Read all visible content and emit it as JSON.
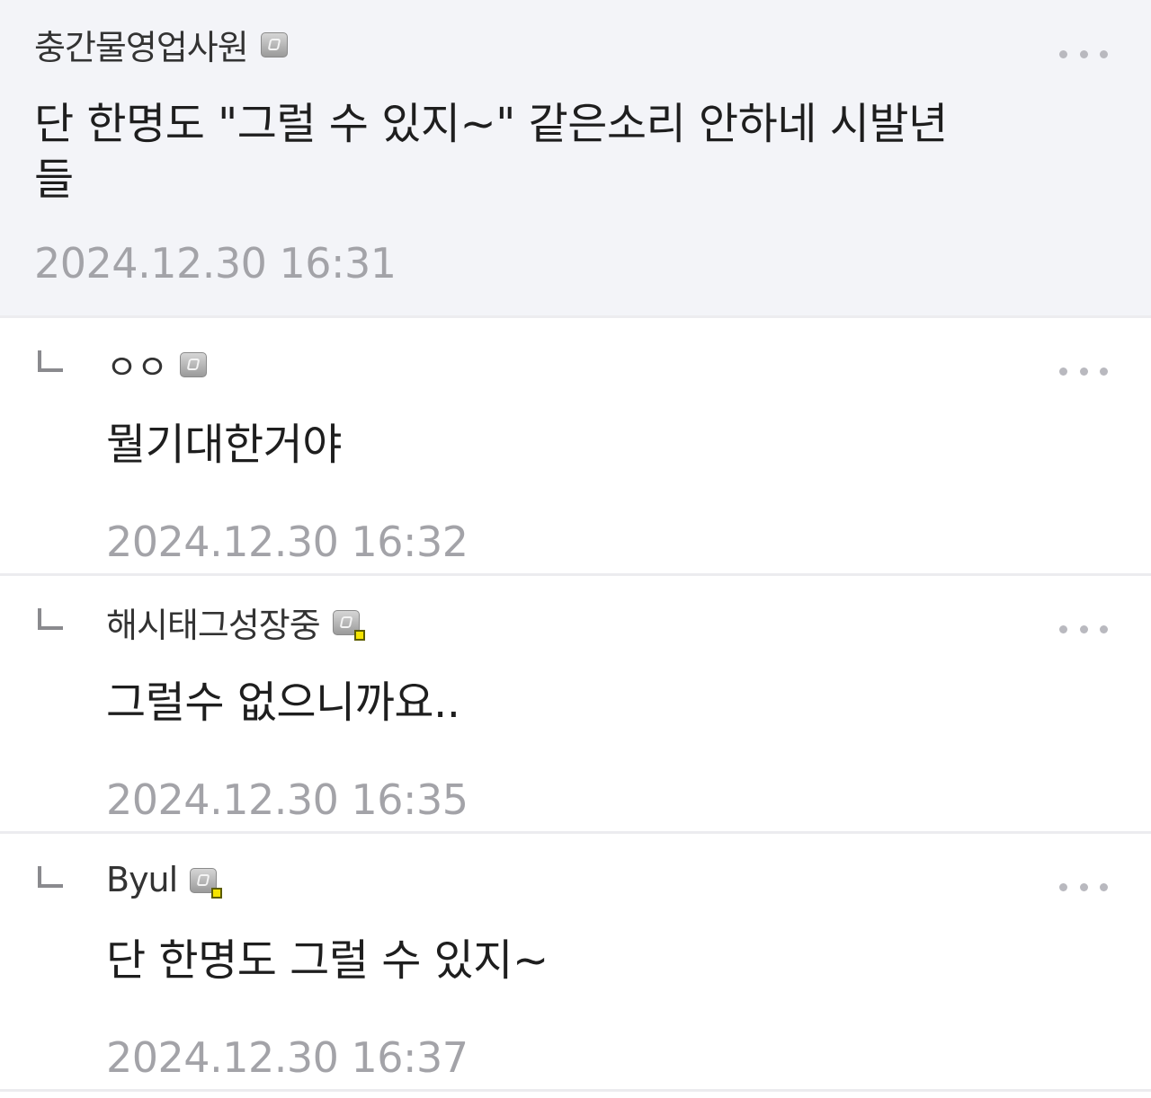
{
  "comments": [
    {
      "author": "충간물영업사원",
      "level_icon": "member-level-icon",
      "text": "단 한명도 \"그럴 수 있지~\" 같은소리 안하네 시발년들",
      "date": "2024.12.30 16:31",
      "highlighted": true
    },
    {
      "author": "ㅇㅇ",
      "level_icon": "member-level-icon",
      "text": "뭘기대한거야",
      "date": "2024.12.30 16:32",
      "reply": true
    },
    {
      "author": "해시태그성장중",
      "level_icon": "member-level-badge-icon",
      "text": "그럴수 없으니까요..",
      "date": "2024.12.30 16:35",
      "reply": true
    },
    {
      "author": "Byul",
      "level_icon": "member-level-badge-icon",
      "text": "단 한명도 그럴 수 있지~",
      "date": "2024.12.30 16:37",
      "reply": true
    }
  ],
  "colors": {
    "highlight_bg": "#f3f4f8",
    "date_text": "#a3a3a8",
    "divider": "#ececef",
    "more_dots": "#b9b9bf"
  }
}
